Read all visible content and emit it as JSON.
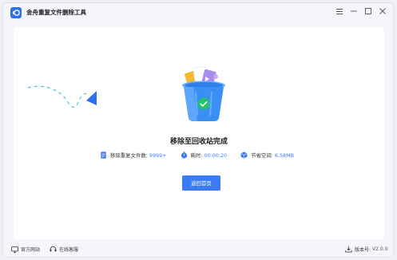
{
  "window": {
    "title": "金舟重复文件删除工具",
    "controls": [
      "menu-icon",
      "minimize-icon",
      "maximize-icon",
      "close-icon"
    ]
  },
  "result": {
    "heading": "移除至回收站完成",
    "stats": [
      {
        "label": "移除重复文件数:",
        "value": "9999+",
        "icon": "document-icon"
      },
      {
        "label": "耗时:",
        "value": "00:00:20",
        "icon": "timer-icon"
      },
      {
        "label": "节省空间:",
        "value": "6.58MB",
        "icon": "storage-cube-icon"
      }
    ],
    "home_button": "返回首页"
  },
  "footer": {
    "website": "官方网站",
    "support": "在线客服",
    "version_label": "版本号:",
    "version_value": "V2.0.0"
  },
  "colors": {
    "accent": "#3d7bf5",
    "bin_blue": "#3a8ff5",
    "check_green": "#22c36b"
  }
}
